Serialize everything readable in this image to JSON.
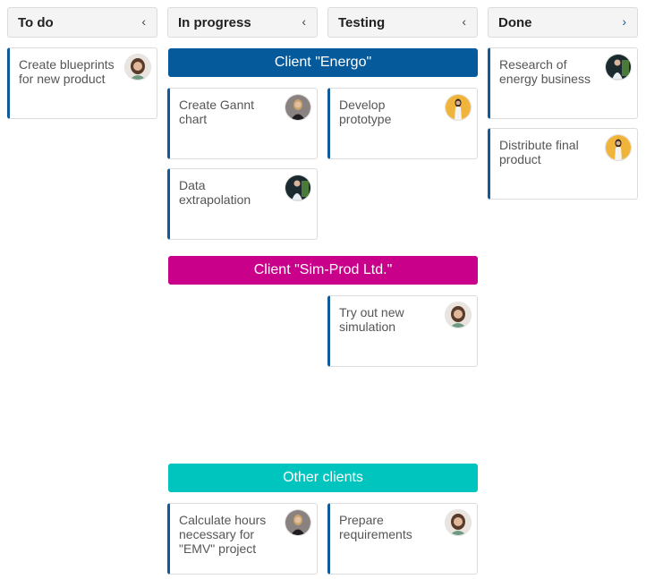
{
  "columns": [
    {
      "title": "To do",
      "toggle": "‹"
    },
    {
      "title": "In progress",
      "toggle": "‹"
    },
    {
      "title": "Testing",
      "toggle": "‹"
    },
    {
      "title": "Done",
      "toggle": "›"
    }
  ],
  "swimlanes": [
    {
      "title": "Client \"Energo\"",
      "color": "#055a9c"
    },
    {
      "title": "Client \"Sim-Prod Ltd.\"",
      "color": "#c8008a"
    },
    {
      "title": "Other clients",
      "color": "#00c5bf"
    }
  ],
  "cards": {
    "todo_1": {
      "text": "Create blueprints for new product",
      "avatar": "avatar-woman-curly-hair"
    },
    "inprogress_1": {
      "text": "Create Gannt chart",
      "avatar": "avatar-woman-blonde"
    },
    "inprogress_2": {
      "text": "Data extrapolation",
      "avatar": "avatar-man-white-shirt"
    },
    "testing_1": {
      "text": "Develop prototype",
      "avatar": "avatar-woman-yellow-bg"
    },
    "done_1": {
      "text": "Research of energy business",
      "avatar": "avatar-man-white-shirt"
    },
    "done_2": {
      "text": "Distribute final product",
      "avatar": "avatar-woman-yellow-bg"
    },
    "testing_2": {
      "text": "Try out new simulation",
      "avatar": "avatar-woman-curly-hair"
    },
    "inprogress_3": {
      "text": "Calculate hours necessary for \"EMV\" project",
      "avatar": "avatar-woman-blonde"
    },
    "testing_3": {
      "text": "Prepare requirements",
      "avatar": "avatar-woman-curly-hair"
    }
  },
  "accent_color": "#0f5a9a"
}
